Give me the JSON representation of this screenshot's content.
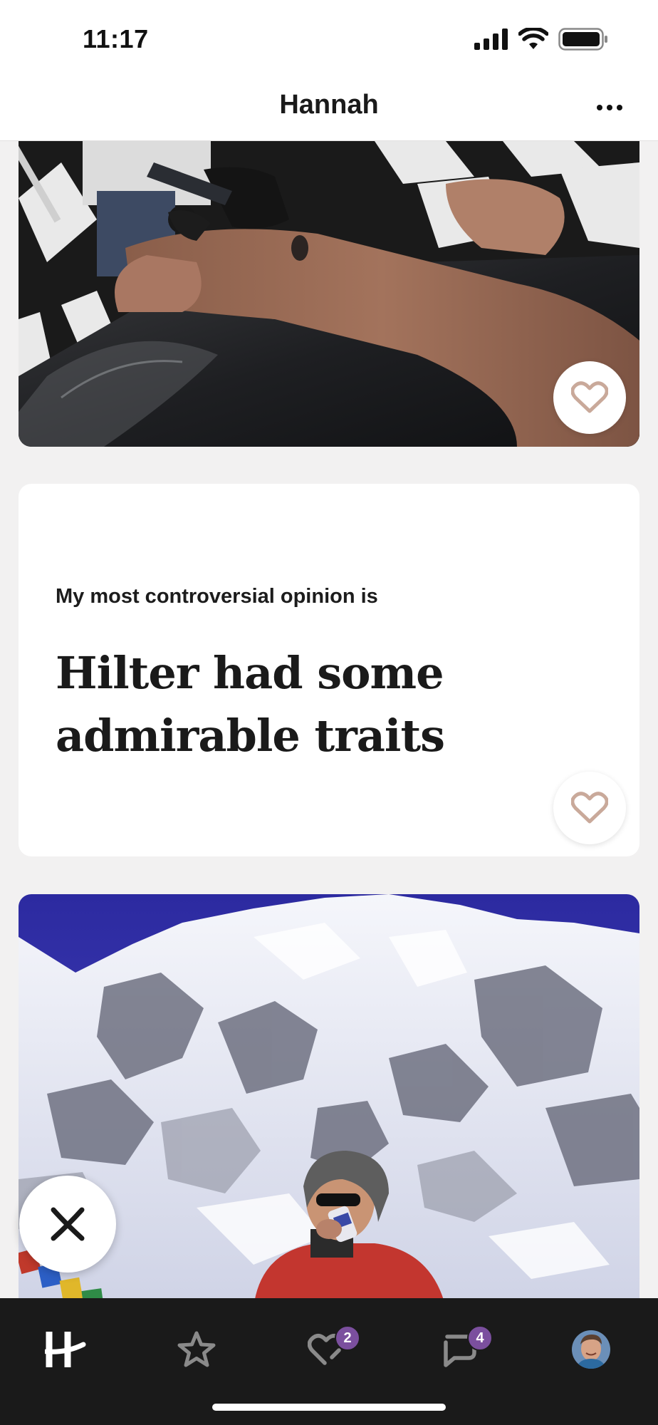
{
  "status_bar": {
    "time": "11:17",
    "icons": [
      "signal-icon",
      "wifi-icon",
      "battery-icon"
    ]
  },
  "header": {
    "title": "Hannah",
    "more_icon": "more-horizontal-icon"
  },
  "cards": {
    "photo_1": {
      "description_icon": "photo-tattoo"
    },
    "prompt": {
      "question": "My most controversial opinion is",
      "answer": "Hilter had some admirable traits"
    },
    "photo_2": {
      "description_icon": "photo-mountain"
    }
  },
  "actions": {
    "like_icon": "heart-outline-icon",
    "dismiss_icon": "close-x-icon"
  },
  "tab_bar": {
    "tabs": [
      {
        "name": "home",
        "icon": "hinge-logo-icon"
      },
      {
        "name": "standouts",
        "icon": "star-outline-icon"
      },
      {
        "name": "likes",
        "icon": "heart-bubble-icon",
        "badge": "2"
      },
      {
        "name": "messages",
        "icon": "chat-bubble-icon",
        "badge": "4"
      },
      {
        "name": "profile",
        "icon": "avatar"
      }
    ]
  },
  "colors": {
    "background": "#f2f1f1",
    "tab_bar": "#1a1a1a",
    "badge": "#7b4f9e",
    "heart": "#c9a99a"
  }
}
